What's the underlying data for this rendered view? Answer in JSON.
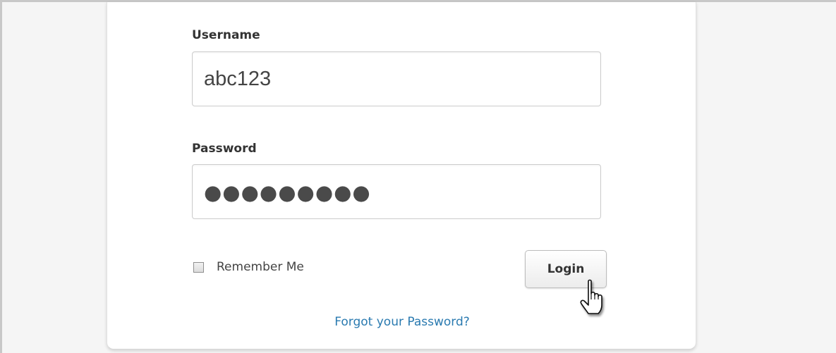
{
  "form": {
    "username_label": "Username",
    "username_value": "abc123",
    "password_label": "Password",
    "password_masked": "●●●●●●●●●",
    "remember_label": "Remember Me",
    "remember_checked": false,
    "login_label": "Login",
    "forgot_label": "Forgot your Password?"
  },
  "colors": {
    "link": "#2a7ab0",
    "background": "#f5f5f5",
    "card": "#ffffff"
  },
  "icons": {
    "cursor": "hand-pointer-icon"
  }
}
